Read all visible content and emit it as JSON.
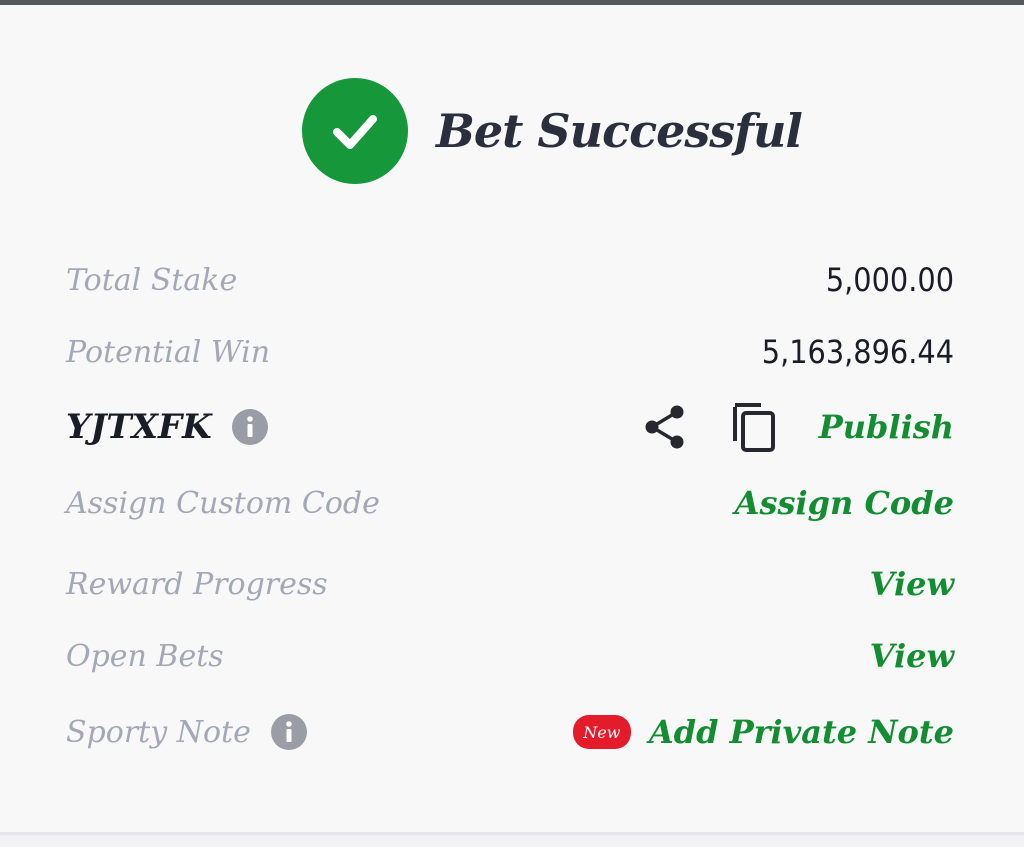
{
  "header": {
    "title": "Bet Successful",
    "icon": "check-circle-icon",
    "color": "#16983a"
  },
  "summary": {
    "total_stake_label": "Total Stake",
    "total_stake_value": "5,000.00",
    "potential_win_label": "Potential Win",
    "potential_win_value": "5,163,896.44"
  },
  "booking": {
    "code": "YJTXFK",
    "publish_label": "Publish"
  },
  "custom_code": {
    "label": "Assign Custom Code",
    "action": "Assign Code"
  },
  "reward": {
    "label": "Reward Progress",
    "action": "View"
  },
  "open_bets": {
    "label": "Open Bets",
    "action": "View"
  },
  "note": {
    "label": "Sporty Note",
    "badge": "New",
    "action": "Add Private Note"
  },
  "colors": {
    "accent": "#138d32",
    "badge": "#e41b2b",
    "muted": "#a4a7b5"
  }
}
